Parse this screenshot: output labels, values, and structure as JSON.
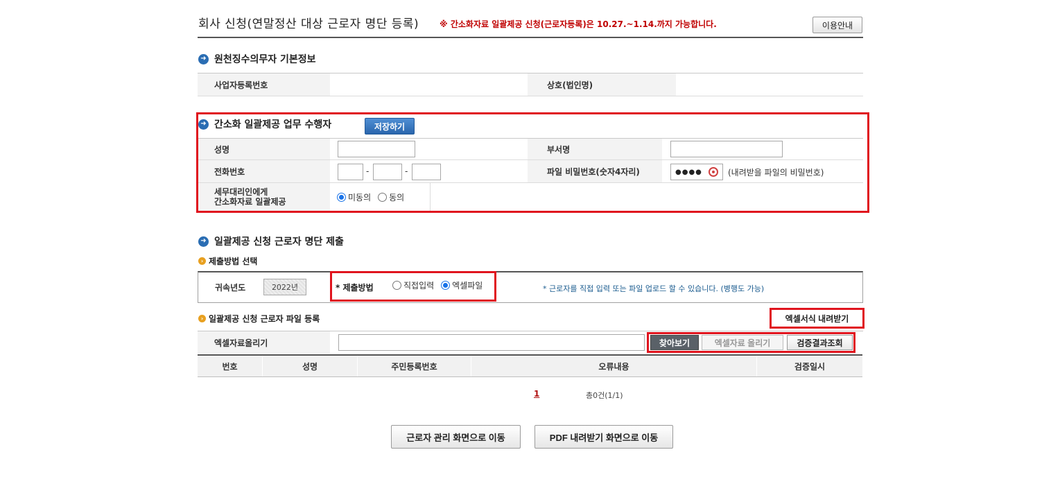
{
  "header": {
    "title": "회사 신청(연말정산 대상 근로자 명단 등록)",
    "notice": "※ 간소화자료 일괄제공 신청(근로자등록)은 10.27.~1.14.까지 가능합니다.",
    "guide_button": "이용안내"
  },
  "withholder": {
    "section_title": "원천징수의무자 기본정보",
    "business_number_label": "사업자등록번호",
    "business_number_value": "",
    "company_name_label": "상호(법인명)",
    "company_name_value": ""
  },
  "performer": {
    "section_title": "간소화 일괄제공 업무 수행자",
    "save_button": "저장하기",
    "name_label": "성명",
    "name_value": "",
    "dept_label": "부서명",
    "dept_value": "",
    "phone_label": "전화번호",
    "phone_dash": "-",
    "phone_1": "",
    "phone_2": "",
    "phone_3": "",
    "file_pw_label": "파일 비밀번호(숫자4자리)",
    "file_pw_mask": "●●●●",
    "file_pw_hint": "(내려받을 파일의 비밀번호)",
    "agent_consent_label_line1": "세무대리인에게",
    "agent_consent_label_line2": "간소화자료 일괄제공",
    "consent_options": [
      "미동의",
      "동의"
    ],
    "consent_selected": "미동의"
  },
  "submission": {
    "section_title": "일괄제공 신청 근로자 명단 제출",
    "method_subtitle": "제출방법 선택",
    "year_label": "귀속년도",
    "year_value": "2022년",
    "method_label": "* 제출방법",
    "method_options": [
      "직접입력",
      "엑셀파일"
    ],
    "method_selected": "엑셀파일",
    "method_note": "* 근로자를 직접 입력 또는 파일 업로드 할 수 있습니다. (병행도 가능)",
    "file_subtitle": "일괄제공 신청 근로자 파일 등록",
    "excel_template_button": "엑셀서식 내려받기",
    "upload_label": "엑셀자료올리기",
    "upload_value": "",
    "browse_button": "찾아보기",
    "upload_button": "엑셀자료 올리기",
    "verify_button": "검증결과조회"
  },
  "result_table": {
    "columns": [
      "번호",
      "성명",
      "주민등록번호",
      "오류내용",
      "검증일시"
    ],
    "rows": []
  },
  "pagination": {
    "current_page": "1",
    "summary": "총0건(1/1)"
  },
  "footer": {
    "worker_mgmt_button": "근로자 관리 화면으로 이동",
    "pdf_download_button": "PDF 내려받기 화면으로 이동"
  }
}
